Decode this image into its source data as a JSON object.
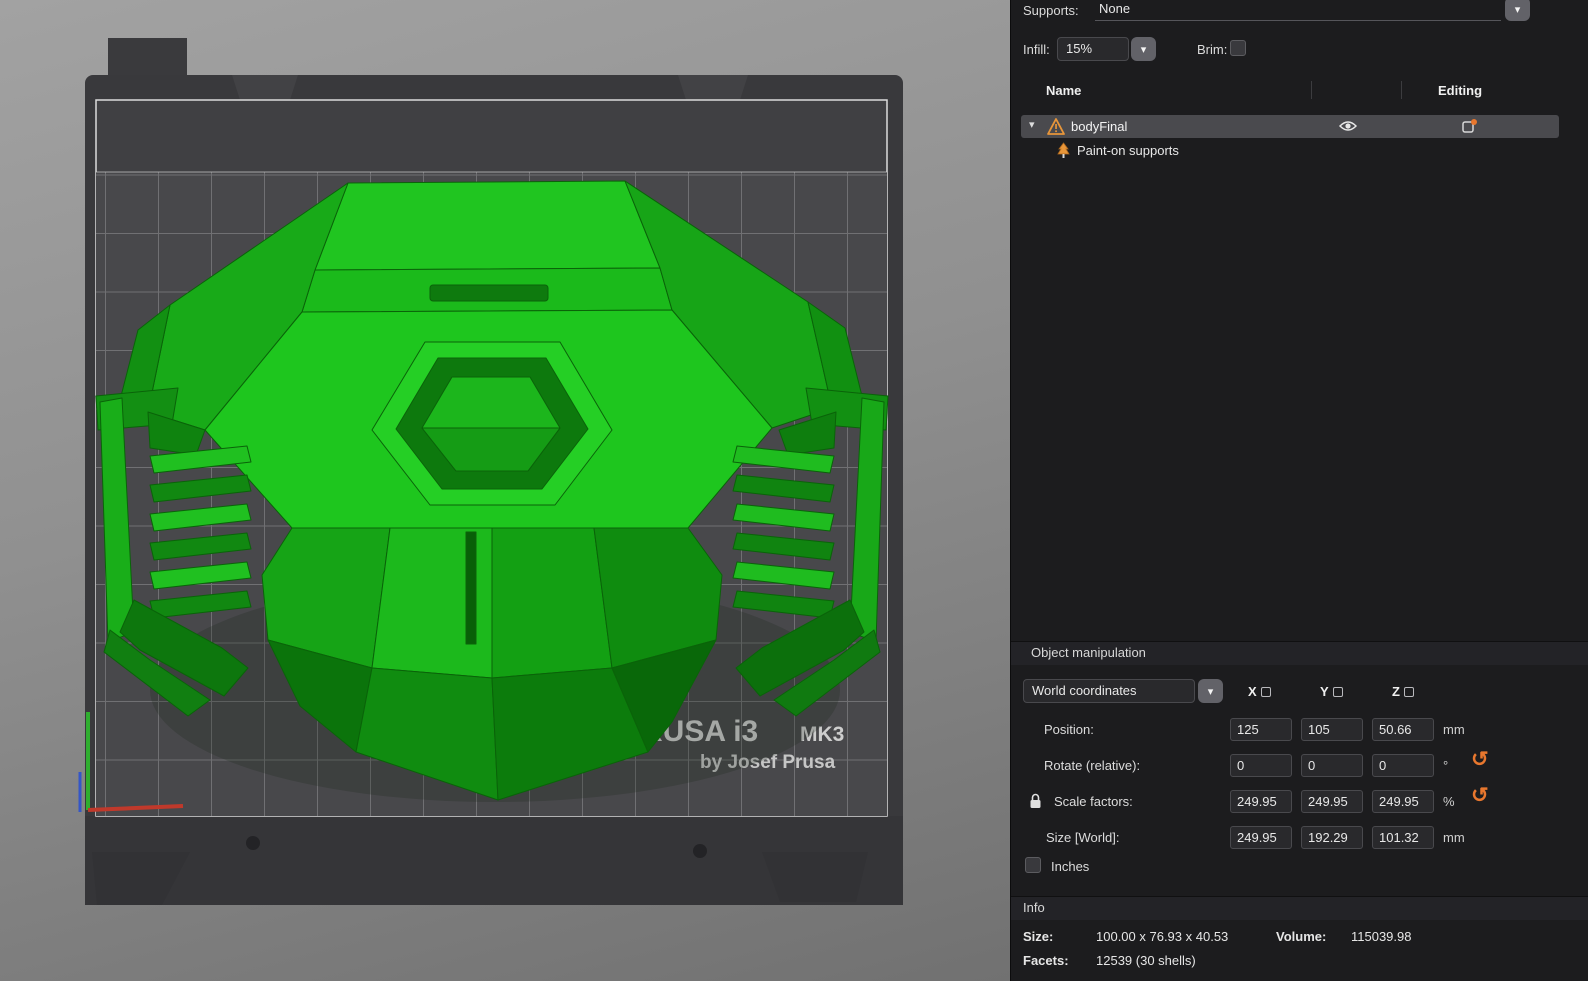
{
  "top_bar": {
    "supports_label": "Supports:",
    "supports_value": "None",
    "infill_label": "Infill:",
    "infill_value": "15%",
    "brim_label": "Brim:"
  },
  "object_list": {
    "name_header": "Name",
    "editing_header": "Editing",
    "selected_object": "bodyFinal",
    "sub_item": "Paint-on supports"
  },
  "manipulation": {
    "title": "Object manipulation",
    "coordinates_value": "World coordinates",
    "axis_x": "X",
    "axis_y": "Y",
    "axis_z": "Z",
    "position": {
      "label": "Position:",
      "x": "125",
      "y": "105",
      "z": "50.66",
      "unit": "mm"
    },
    "rotate": {
      "label": "Rotate (relative):",
      "x": "0",
      "y": "0",
      "z": "0",
      "unit": "°"
    },
    "scale": {
      "label": "Scale factors:",
      "x": "249.95",
      "y": "249.95",
      "z": "249.95",
      "unit": "%"
    },
    "size": {
      "label": "Size [World]:",
      "x": "249.95",
      "y": "192.29",
      "z": "101.32",
      "unit": "mm"
    },
    "inches_label": "Inches"
  },
  "info": {
    "title": "Info",
    "size_label": "Size:",
    "size_value": "100.00 x 76.93 x 40.53",
    "volume_label": "Volume:",
    "volume_value": "115039.98",
    "facets_label": "Facets:",
    "facets_value": "12539 (30 shells)"
  },
  "bed": {
    "brand": "RUSA i3",
    "model": "MK3",
    "byline": "by Josef Prusa"
  },
  "colors": {
    "accent_orange": "#e8772e",
    "model_green": "#1ec61e",
    "panel_bg": "#1c1c1e"
  }
}
